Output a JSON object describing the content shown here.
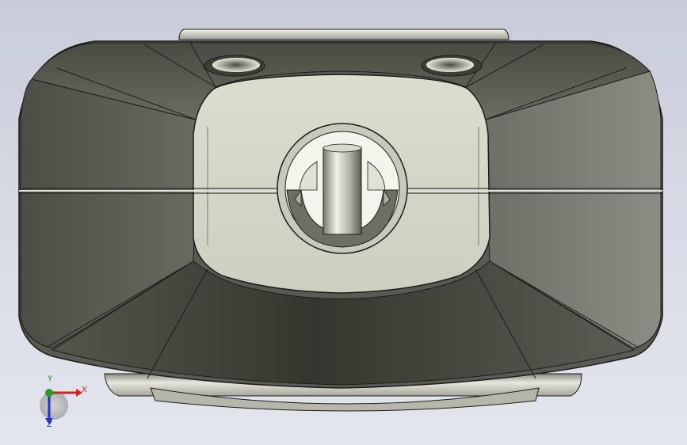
{
  "viewport": {
    "background_top": "#c9ccd9",
    "background_bottom": "#e4e6ee"
  },
  "model": {
    "body_color_dark": "#3c3c34",
    "body_color_mid": "#707068",
    "face_color_light": "#d6d6c8",
    "edge_color": "#1c1c1c"
  },
  "triad": {
    "x_label": "X",
    "y_label": "Y",
    "z_label": "Z",
    "x_color": "#d4221c",
    "y_color": "#2a9a2a",
    "z_color": "#2434c4"
  }
}
